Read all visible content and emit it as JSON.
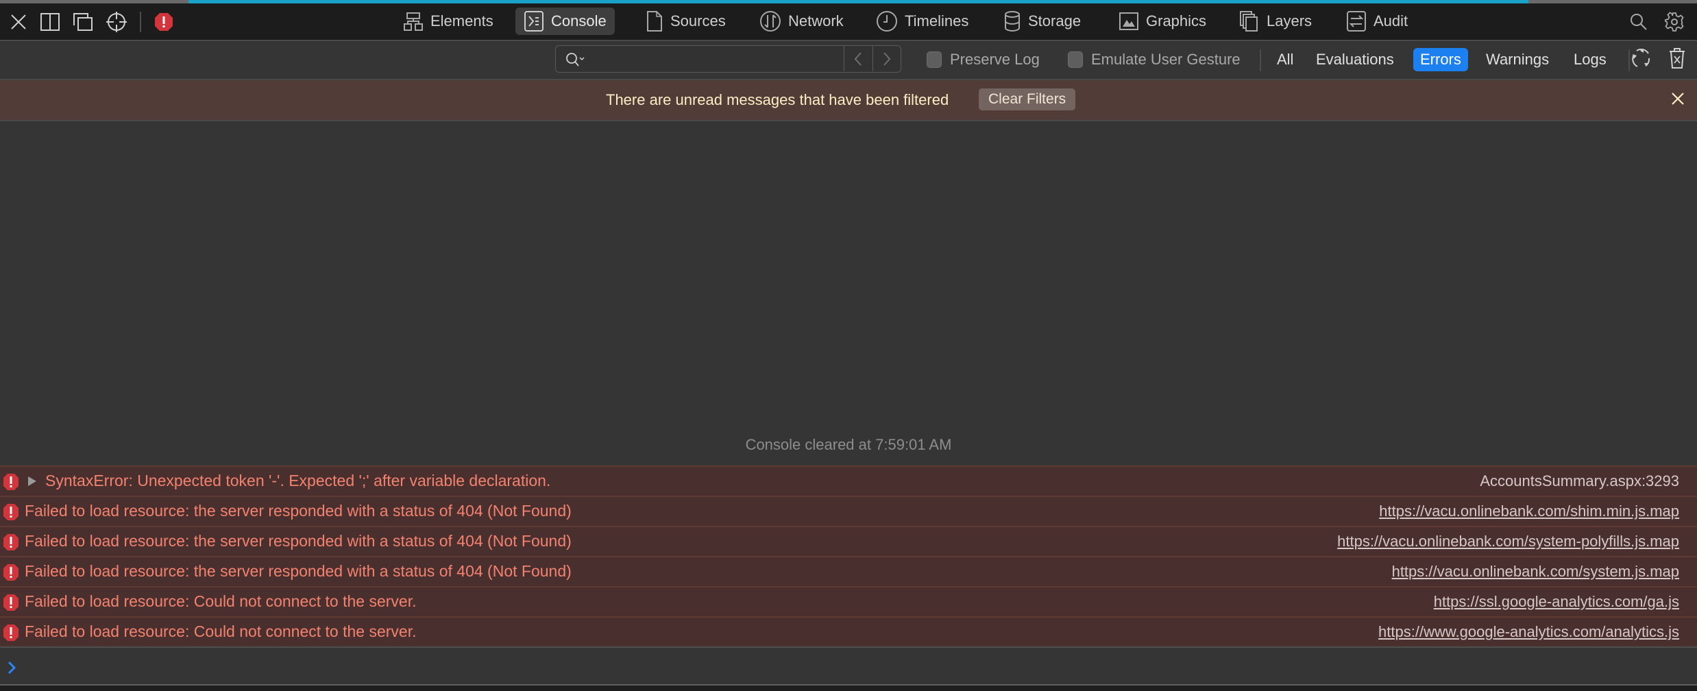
{
  "window_controls": {
    "close": "close-icon",
    "dock_side": "dock-side-icon",
    "undock": "undock-icon",
    "inspect": "crosshair-icon",
    "error_indicator": "error-icon"
  },
  "tabs": [
    {
      "label": "Elements",
      "icon": "elements-icon",
      "active": false
    },
    {
      "label": "Console",
      "icon": "console-icon",
      "active": true
    },
    {
      "label": "Sources",
      "icon": "sources-icon",
      "active": false
    },
    {
      "label": "Network",
      "icon": "network-icon",
      "active": false
    },
    {
      "label": "Timelines",
      "icon": "timelines-icon",
      "active": false
    },
    {
      "label": "Storage",
      "icon": "storage-icon",
      "active": false
    },
    {
      "label": "Graphics",
      "icon": "graphics-icon",
      "active": false
    },
    {
      "label": "Layers",
      "icon": "layers-icon",
      "active": false
    },
    {
      "label": "Audit",
      "icon": "audit-icon",
      "active": false
    }
  ],
  "toolbar_right": {
    "search": "search-icon",
    "settings": "gear-icon"
  },
  "filter": {
    "search_value": "",
    "search_placeholder": "",
    "preserve_log_label": "Preserve Log",
    "preserve_log_checked": false,
    "emulate_gesture_label": "Emulate User Gesture",
    "emulate_gesture_checked": false,
    "levels": [
      {
        "label": "All",
        "active": false
      },
      {
        "label": "Evaluations",
        "active": false
      },
      {
        "label": "Errors",
        "active": true
      },
      {
        "label": "Warnings",
        "active": false
      },
      {
        "label": "Logs",
        "active": false
      }
    ]
  },
  "banner": {
    "message": "There are unread messages that have been filtered",
    "button_label": "Clear Filters"
  },
  "console": {
    "cleared_message": "Console cleared at 7:59:01 AM",
    "messages": [
      {
        "text": "SyntaxError: Unexpected token '-'. Expected ';' after variable declaration.",
        "source": "AccountsSummary.aspx:3293",
        "expandable": true,
        "link": false
      },
      {
        "text": "Failed to load resource: the server responded with a status of 404 (Not Found)",
        "source": "https://vacu.onlinebank.com/shim.min.js.map",
        "expandable": false,
        "link": true
      },
      {
        "text": "Failed to load resource: the server responded with a status of 404 (Not Found)",
        "source": "https://vacu.onlinebank.com/system-polyfills.js.map",
        "expandable": false,
        "link": true
      },
      {
        "text": "Failed to load resource: the server responded with a status of 404 (Not Found)",
        "source": "https://vacu.onlinebank.com/system.js.map",
        "expandable": false,
        "link": true
      },
      {
        "text": "Failed to load resource: Could not connect to the server.",
        "source": "https://ssl.google-analytics.com/ga.js",
        "expandable": false,
        "link": true
      },
      {
        "text": "Failed to load resource: Could not connect to the server.",
        "source": "https://www.google-analytics.com/analytics.js",
        "expandable": false,
        "link": true
      }
    ],
    "prompt_value": ""
  },
  "colors": {
    "accent": "#1d80f0",
    "error_text": "#f3826e",
    "error_row_bg": "#4a2f2f",
    "banner_bg": "#513c37",
    "error_icon": "#d2363c"
  }
}
